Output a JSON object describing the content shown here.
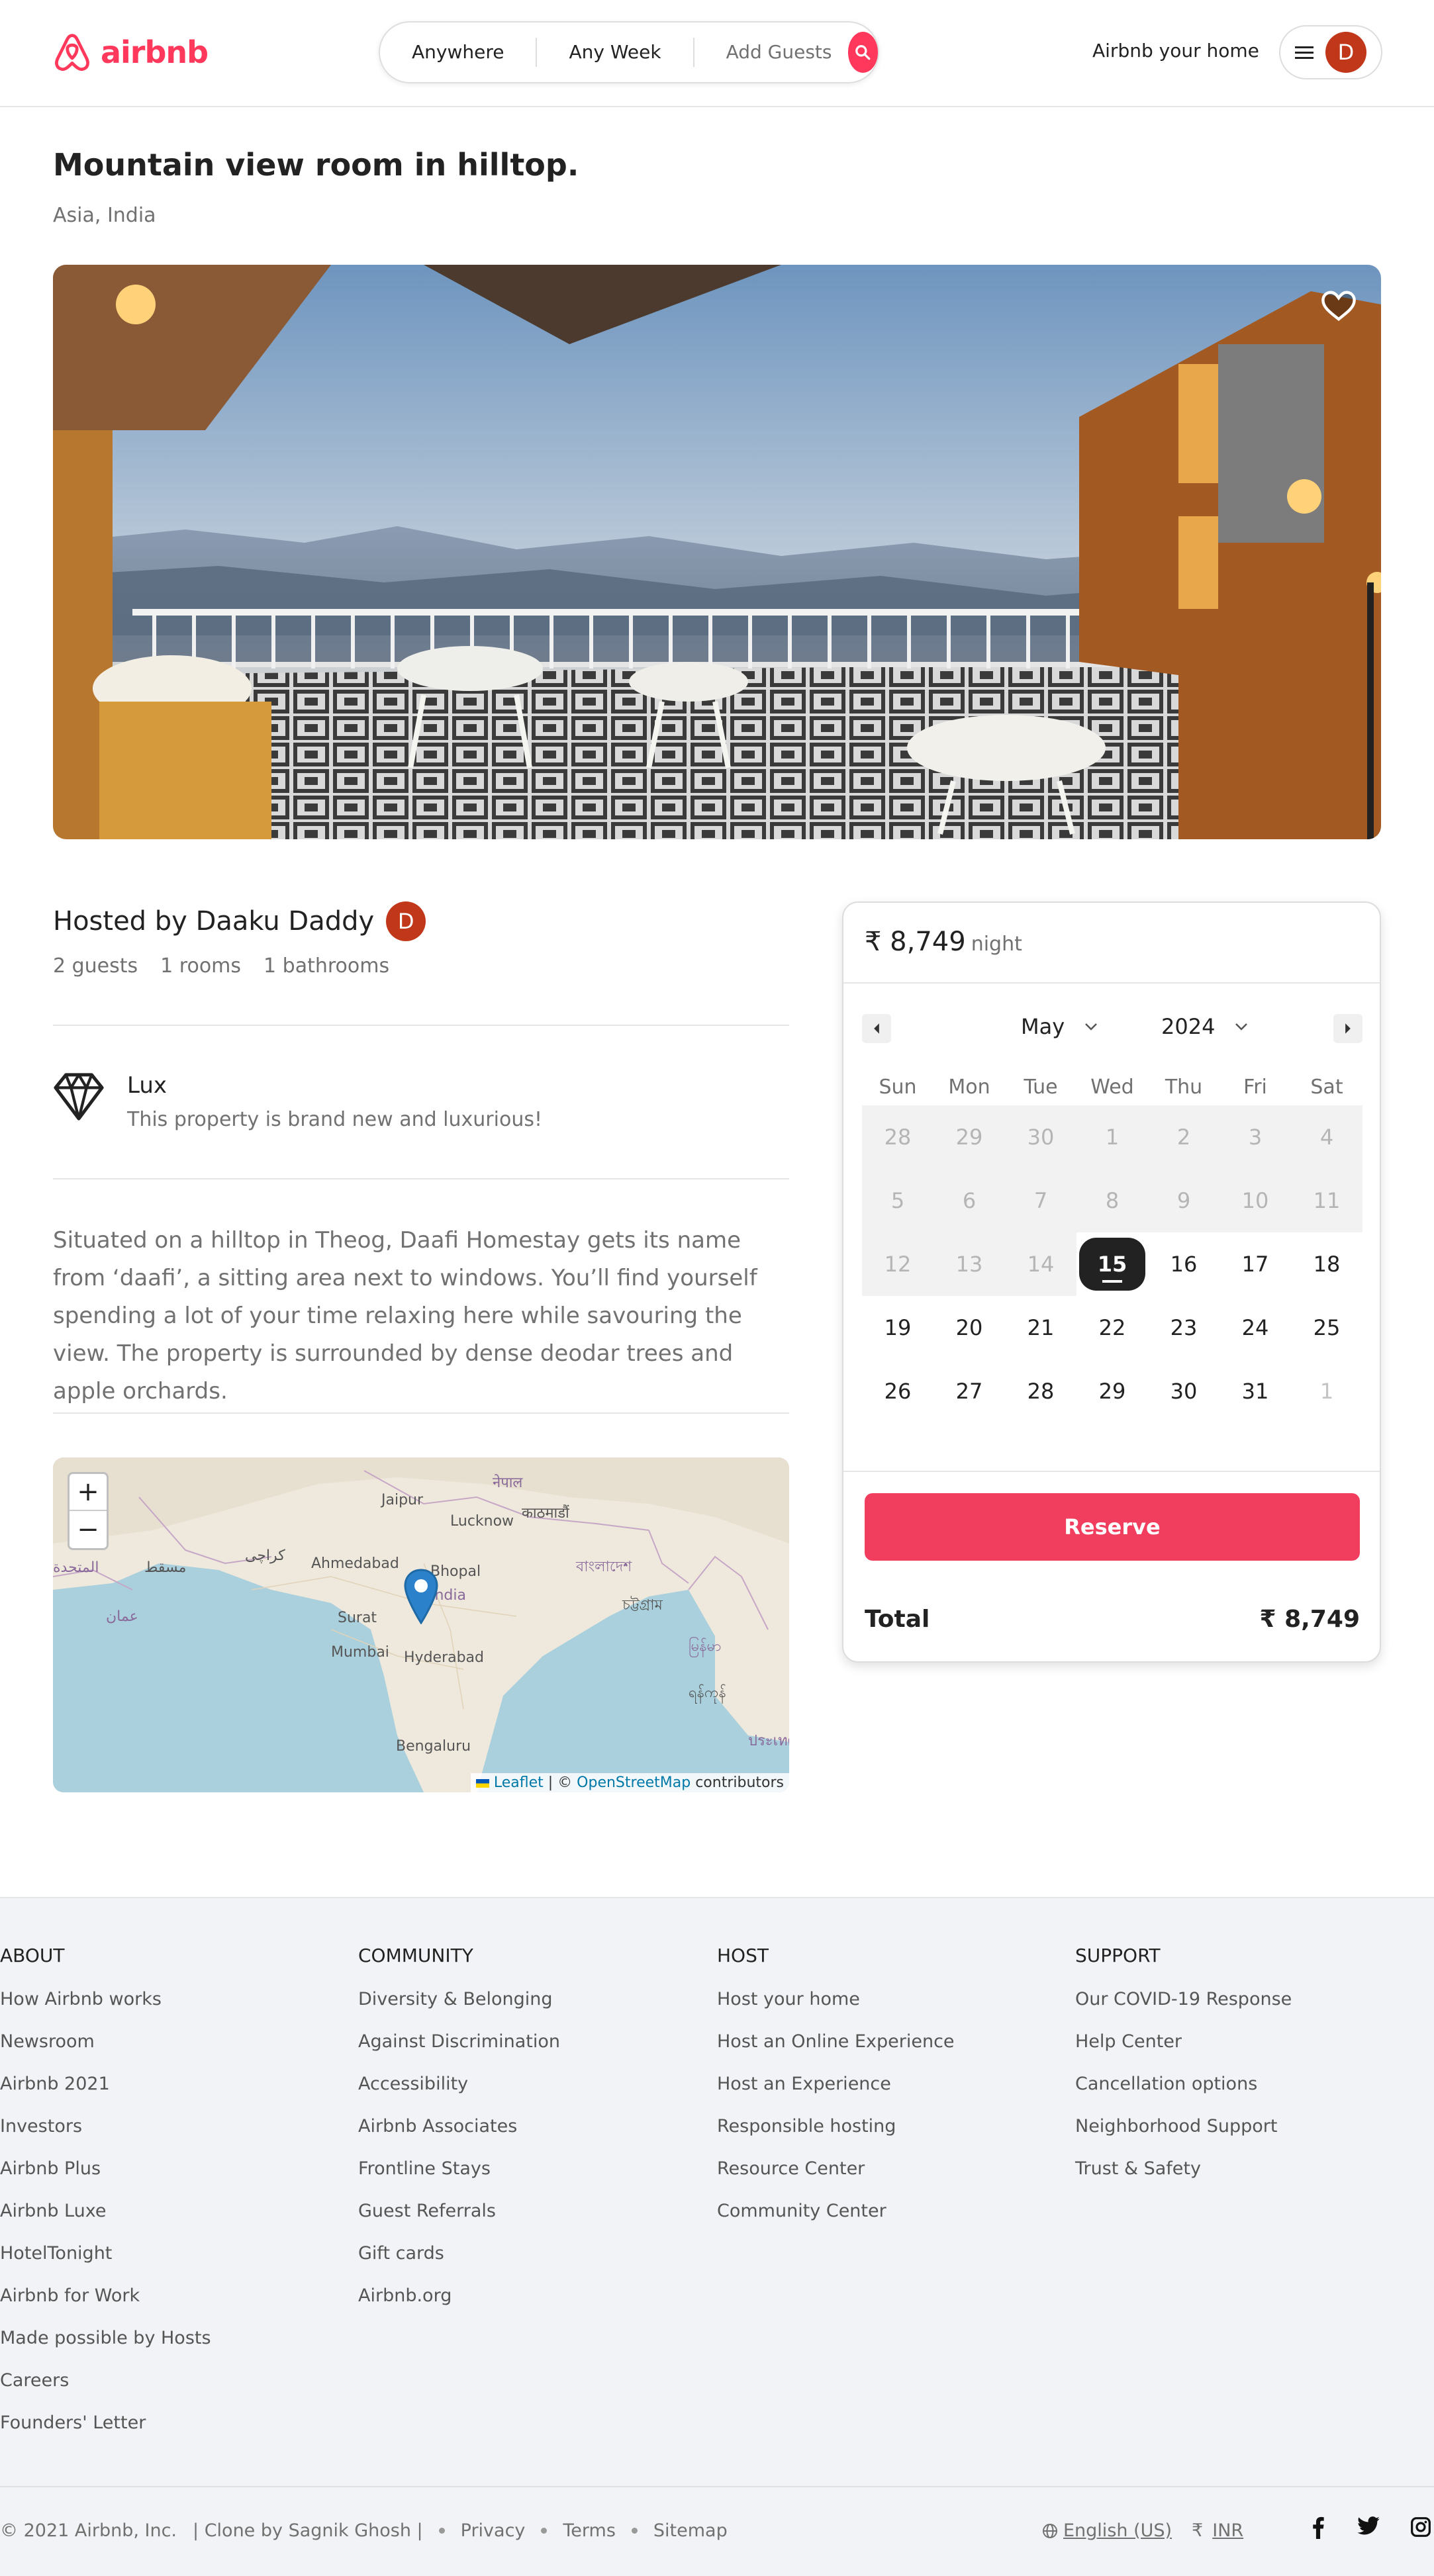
{
  "header": {
    "logo_text": "airbnb",
    "search": {
      "where": "Anywhere",
      "week": "Any Week",
      "guests": "Add Guests"
    },
    "host_link": "Airbnb your home",
    "user_initial": "D"
  },
  "listing": {
    "title": "Mountain view room in hilltop.",
    "location": "Asia, India",
    "host": "Hosted by Daaku Daddy",
    "host_initial": "D",
    "meta": [
      "2 guests",
      "1 rooms",
      "1 bathrooms"
    ],
    "feature": {
      "title": "Lux",
      "description": "This property is brand new and luxurious!"
    },
    "description": "Situated on a hilltop in Theog, Daafi Homestay gets its name from ‘daafi’, a sitting area next to windows. You’ll find yourself spending a lot of your time relaxing here while savouring the view. The property is surrounded by dense deodar trees and apple orchards."
  },
  "map": {
    "zoom_in": "+",
    "zoom_out": "−",
    "attribution_leaflet": "Leaflet",
    "attribution_sep": "| ©",
    "attribution_osm": "OpenStreetMap",
    "attribution_tail": "contributors",
    "labels": {
      "jaipur": "Jaipur",
      "lucknow": "Lucknow",
      "nepal": "नेपाल",
      "kathmandu": "काठमाडौं",
      "karachi": "کراچی",
      "muscat": "مسقط",
      "ahmedabad": "Ahmedabad",
      "bhopal": "Bhopal",
      "india": "India",
      "bangladesh": "বাংলাদেশ",
      "chittagong": "চট্টগ্রাম",
      "oman": "عمان",
      "surat": "Surat",
      "mumbai": "Mumbai",
      "hyderabad": "Hyderabad",
      "bengaluru": "Bengaluru",
      "myanmar": "မြန်မာ",
      "yangon": "ရန်ကုန်",
      "thailand": "ประเทศไทย",
      "uae": "المتحدة"
    }
  },
  "booking": {
    "price": "₹ 8,749",
    "price_unit": "night",
    "month": "May",
    "year": "2024",
    "weekdays": [
      "Sun",
      "Mon",
      "Tue",
      "Wed",
      "Thu",
      "Fri",
      "Sat"
    ],
    "weeks": [
      [
        "28",
        "29",
        "30",
        "1",
        "2",
        "3",
        "4"
      ],
      [
        "5",
        "6",
        "7",
        "8",
        "9",
        "10",
        "11"
      ],
      [
        "12",
        "13",
        "14",
        "15",
        "16",
        "17",
        "18"
      ],
      [
        "19",
        "20",
        "21",
        "22",
        "23",
        "24",
        "25"
      ],
      [
        "26",
        "27",
        "28",
        "29",
        "30",
        "31",
        "1"
      ]
    ],
    "selected_day": "15",
    "reserve_label": "Reserve",
    "total_label": "Total",
    "total_value": "₹ 8,749"
  },
  "footer": {
    "columns": [
      {
        "heading": "ABOUT",
        "links": [
          "How Airbnb works",
          "Newsroom",
          "Airbnb 2021",
          "Investors",
          "Airbnb Plus",
          "Airbnb Luxe",
          "HotelTonight",
          "Airbnb for Work",
          "Made possible by Hosts",
          "Careers",
          "Founders' Letter"
        ]
      },
      {
        "heading": "COMMUNITY",
        "links": [
          "Diversity & Belonging",
          "Against Discrimination",
          "Accessibility",
          "Airbnb Associates",
          "Frontline Stays",
          "Guest Referrals",
          "Gift cards",
          "Airbnb.org"
        ]
      },
      {
        "heading": "HOST",
        "links": [
          "Host your home",
          "Host an Online Experience",
          "Host an Experience",
          "Responsible hosting",
          "Resource Center",
          "Community Center"
        ]
      },
      {
        "heading": "SUPPORT",
        "links": [
          "Our COVID-19 Response",
          "Help Center",
          "Cancellation options",
          "Neighborhood Support",
          "Trust & Safety"
        ]
      }
    ],
    "copyright": "© 2021 Airbnb, Inc.",
    "clone_credit": "| Clone by Sagnik Ghosh |",
    "privacy": "Privacy",
    "terms": "Terms",
    "sitemap": "Sitemap",
    "language": "English (US)",
    "currency_symbol": "₹",
    "currency": "INR"
  },
  "colors": {
    "brand": "#ff385c",
    "reserve": "#f13d5e",
    "avatar": "#c1371a"
  }
}
